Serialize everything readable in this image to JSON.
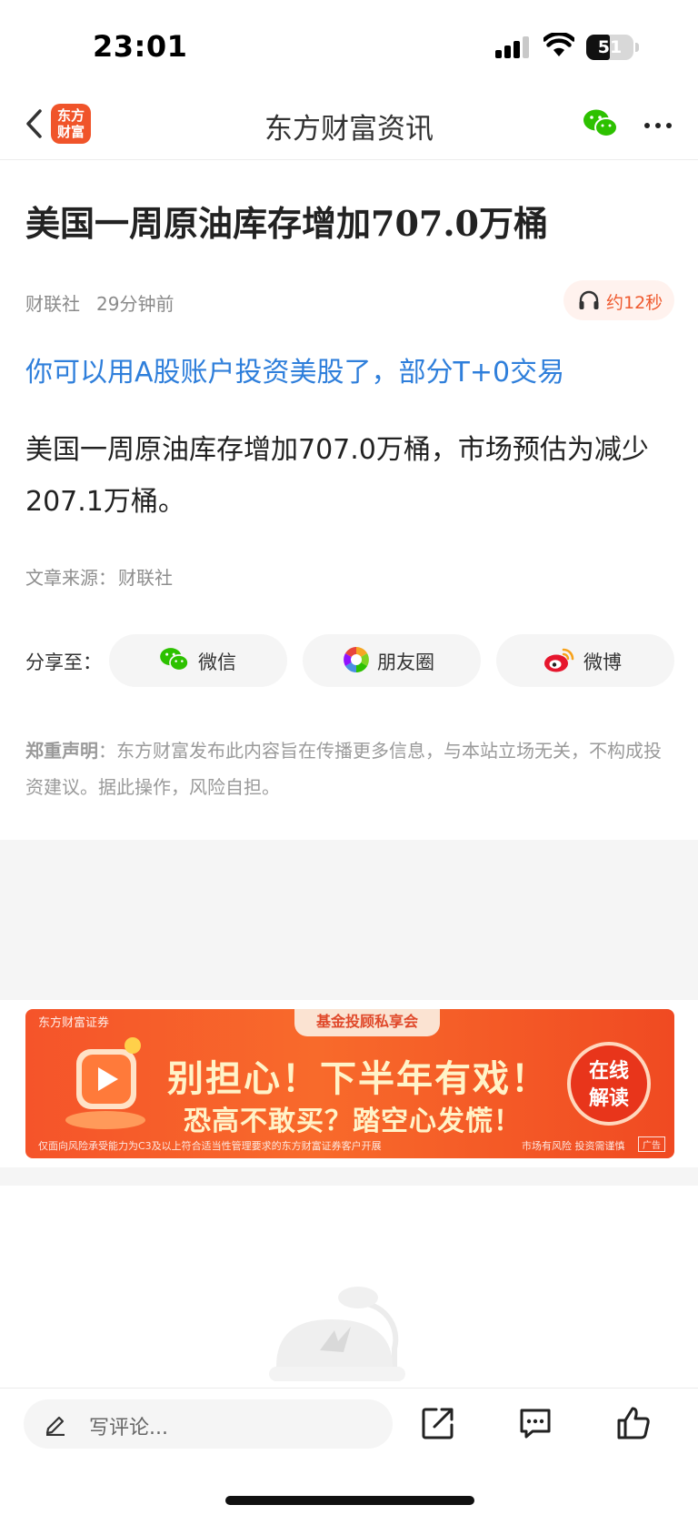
{
  "status_bar": {
    "time": "23:01",
    "battery": "51"
  },
  "header": {
    "title": "东方财富资讯",
    "logo_text": "东方财富"
  },
  "article": {
    "headline": "美国一周原油库存增加707.0万桶",
    "source_name": "财联社",
    "time_ago": "29分钟前",
    "listen_label": "约12秒",
    "promo_link": "你可以用A股账户投资美股了，部分T+0交易",
    "body": "美国一周原油库存增加707.0万桶，市场预估为减少207.1万桶。",
    "source_label": "文章来源：",
    "source_value": "财联社"
  },
  "share": {
    "label": "分享至：",
    "buttons": [
      {
        "label": "微信",
        "icon": "wechat-icon"
      },
      {
        "label": "朋友圈",
        "icon": "moments-icon"
      },
      {
        "label": "微博",
        "icon": "weibo-icon"
      }
    ]
  },
  "disclaimer": {
    "title": "郑重声明",
    "text": "：东方财富发布此内容旨在传播更多信息，与本站立场无关，不构成投资建议。据此操作，风险自担。"
  },
  "ad": {
    "brand": "东方财富证券",
    "tag": "基金投顾私享会",
    "main": "别担心！下半年有戏！",
    "sub": "恐高不敢买？踏空心发慌！",
    "cta": "在线解读",
    "footer_left": "仅面向风险承受能力为C3及以上符合适当性管理要求的东方财富证券客户开展",
    "footer_right": "市场有风险 投资需谨慎",
    "badge": "广告"
  },
  "bottom_bar": {
    "comment_placeholder": "写评论...",
    "icons": [
      "share-icon",
      "comment-icon",
      "like-icon"
    ]
  },
  "colors": {
    "brand": "#f0542a",
    "link": "#2f7fdb",
    "listen_text": "#ef5a2f",
    "wechat_green": "#2dc100"
  }
}
